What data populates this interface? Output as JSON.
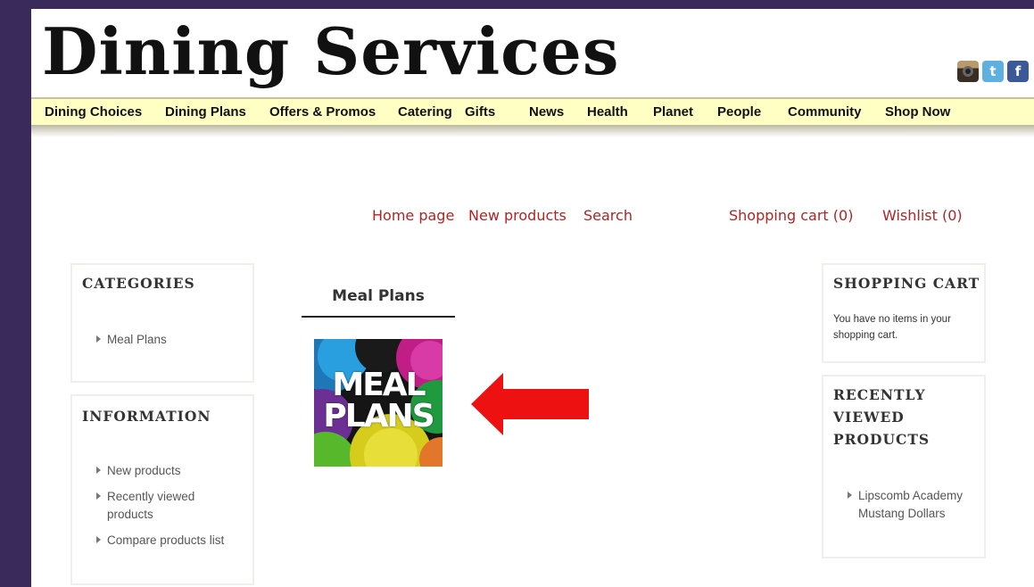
{
  "site": {
    "title": "Dining Services"
  },
  "social": {
    "icons": [
      "instagram-icon",
      "twitter-icon",
      "facebook-icon"
    ]
  },
  "nav": {
    "items": [
      "Dining Choices",
      "Dining Plans",
      "Offers & Promos",
      "Catering",
      "Gifts",
      "News",
      "Health",
      "Planet",
      "People",
      "Community",
      "Shop Now"
    ]
  },
  "toplinks": {
    "home": "Home page",
    "new_products": "New products",
    "search": "Search",
    "cart": "Shopping cart (0)",
    "wishlist": "Wishlist (0)"
  },
  "categories": {
    "title": "CATEGORIES",
    "items": [
      "Meal Plans"
    ]
  },
  "information": {
    "title": "INFORMATION",
    "items": [
      "New products",
      "Recently viewed products",
      "Compare products list"
    ]
  },
  "main": {
    "category_heading": "Meal Plans",
    "image_text_line1": "MEAL",
    "image_text_line2": "PLANS"
  },
  "shopping_cart": {
    "title": "SHOPPING CART",
    "empty_message": "You have no items in your shopping cart."
  },
  "recently_viewed": {
    "title": "RECENTLY VIEWED PRODUCTS",
    "items": [
      "Lipscomb Academy Mustang Dollars"
    ]
  },
  "colors": {
    "page_background": "#3a2a5c",
    "nav_background": "#ffffc4",
    "link_red": "#b22323",
    "arrow_red": "#ee1111"
  }
}
